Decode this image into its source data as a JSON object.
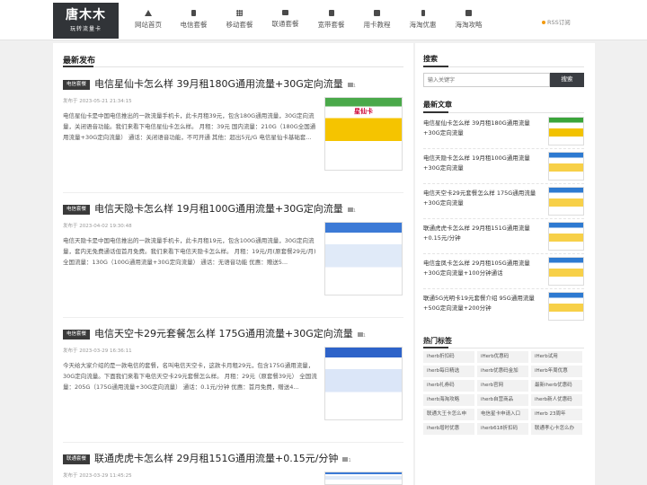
{
  "header": {
    "logo_main": "唐木木",
    "logo_sub": "玩转流量卡",
    "nav": [
      {
        "label": "网站首页",
        "icon": "home-icon"
      },
      {
        "label": "电信套餐",
        "icon": "phone-icon"
      },
      {
        "label": "移动套餐",
        "icon": "grid-icon"
      },
      {
        "label": "联通套餐",
        "icon": "list-icon"
      },
      {
        "label": "宽带套餐",
        "icon": "document-icon"
      },
      {
        "label": "用卡教程",
        "icon": "flag-icon"
      },
      {
        "label": "海淘优惠",
        "icon": "tag-icon"
      },
      {
        "label": "海淘攻略",
        "icon": "book-icon"
      }
    ],
    "rss": "RSS订阅"
  },
  "main": {
    "section_title": "最新发布",
    "posts": [
      {
        "category": "电信套餐",
        "title": "电信星仙卡怎么样 39月租180G通用流量+30G定向流量",
        "comments": "1",
        "date": "发布于 2023-05-21 21:34:15",
        "excerpt": "电信星仙卡是中国电信推出的一款流量手机卡，此卡月租39元，包含180G通用流量，30G定向流量，关闭语音功能。我们来看下电信星仙卡怎么样。 月租：39元 国内流量：210G（180G全国通用流量+30G定向流量） 通话：关闭语音功能，不可开通 其他：超出5元/G 电信星仙卡基础套...",
        "thumb_label": "星仙卡"
      },
      {
        "category": "电信套餐",
        "title": "电信天隐卡怎么样 19月租100G通用流量+30G定向流量",
        "comments": "1",
        "date": "发布于 2023-04-02 19:30:48",
        "excerpt": "电信天隐卡是中国电信推出的一款流量手机卡，此卡月租19元，包含100G通用流量，30G定向流量，套内无免费通话但首月免费。我们来看下电信天隐卡怎么样。 月租：19元/月(原套餐29元/月) 全国流量：130G（100G通用流量+30G定向流量） 通话：无语音功能 优惠：赠送5...",
        "thumb_label": ""
      },
      {
        "category": "电信套餐",
        "title": "电信天空卡29元套餐怎么样 175G通用流量+30G定向流量",
        "comments": "1",
        "date": "发布于 2023-03-29 16:36:11",
        "excerpt": "今天给大家介绍的是一款电信的套餐，名叫电信天空卡，这款卡月租29元，包含175G通用流量，30G定向流量。下面我们来看下电信天空卡29元套餐怎么样。 月租：29元（原套餐39元） 全国流量：205G（175G通用流量+30G定向流量） 通话：0.1元/分钟 优惠：首月免费，赠送4...",
        "thumb_label": ""
      },
      {
        "category": "联通套餐",
        "title": "联通虎虎卡怎么样 29月租151G通用流量+0.15元/分钟",
        "comments": "1",
        "date": "发布于 2023-03-29 11:45:25",
        "excerpt": "",
        "thumb_label": ""
      }
    ]
  },
  "sidebar": {
    "search_title": "搜索",
    "search_placeholder": "输入关键字",
    "search_button": "搜索",
    "latest_title": "最新文章",
    "latest": [
      "电信星仙卡怎么样 39月租180G通用流量+30G定向流量",
      "电信天隐卡怎么样 19月租100G通用流量+30G定向流量",
      "电信天空卡29元套餐怎么样 175G通用流量+30G定向流量",
      "联通虎虎卡怎么样 29月租151G通用流量+0.15元/分钟",
      "电信金凤卡怎么样 29月租105G通用流量+30G定向流量+100分钟通话",
      "联通5G光明卡19元套餐介绍 95G通用流量+50G定向流量+200分钟"
    ],
    "tags_title": "热门标签",
    "tags": [
      "iherb折扣码",
      "iHerb优惠码",
      "iHerb试用",
      "iherb每日精选",
      "iherb优惠码金加",
      "iHerb年周优惠",
      "iherb礼券码",
      "iherb官网",
      "最新iherb优惠码",
      "iherb海淘攻略",
      "iherb自营商品",
      "iherb新人优惠码",
      "联通大王卡怎么申",
      "电信星卡申请入口",
      "iHerb 23周年",
      "iherb增时优惠",
      "iherb618折扣码",
      "联通孝心卡怎么办"
    ]
  },
  "colors": {
    "header_bg": "#ffffff",
    "logo_bg": "#313438",
    "category_badge": "#3a3a3a",
    "rss_dot": "#f29a0f",
    "page_bg": "#f0f0f0"
  }
}
